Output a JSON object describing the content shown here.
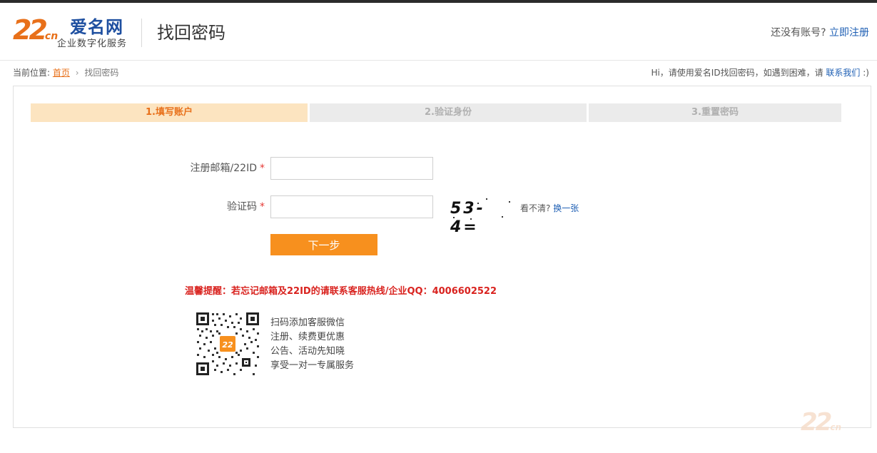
{
  "brand": {
    "logo_mark": "22",
    "logo_mark_suffix": "cn",
    "name": "爱名网",
    "tagline": "企业数字化服务",
    "accent_color": "#e8701a",
    "brand_color": "#1e4fa0"
  },
  "header": {
    "title": "找回密码",
    "no_account_text": "还没有账号?",
    "register_link": "立即注册"
  },
  "breadcrumb": {
    "prefix": "当前位置:",
    "home": "首页",
    "separator": "›",
    "current": "找回密码"
  },
  "help": {
    "text": "Hi，请使用爱名ID找回密码，如遇到困难，请",
    "contact_link": "联系我们",
    "suffix": ":)"
  },
  "steps": [
    {
      "label": "1.填写账户",
      "active": true
    },
    {
      "label": "2.验证身份",
      "active": false
    },
    {
      "label": "3.重置密码",
      "active": false
    }
  ],
  "form": {
    "account_label": "注册邮箱/22ID",
    "account_value": "",
    "code_label": "验证码",
    "code_value": "",
    "required_mark": "*",
    "captcha_text": "53-4=",
    "captcha_hint": "看不清?",
    "captcha_refresh": "换一张",
    "next_button": "下一步"
  },
  "tip": {
    "text": "温馨提醒：若忘记邮箱及22ID的请联系客服热线/企业QQ：4006602522"
  },
  "qr": {
    "icon": "qr-code-icon",
    "lines": [
      "扫码添加客服微信",
      "注册、续费更优惠",
      "公告、活动先知晓",
      "享受一对一专属服务"
    ]
  },
  "watermark": {
    "mark": "22",
    "suffix": "cn"
  }
}
